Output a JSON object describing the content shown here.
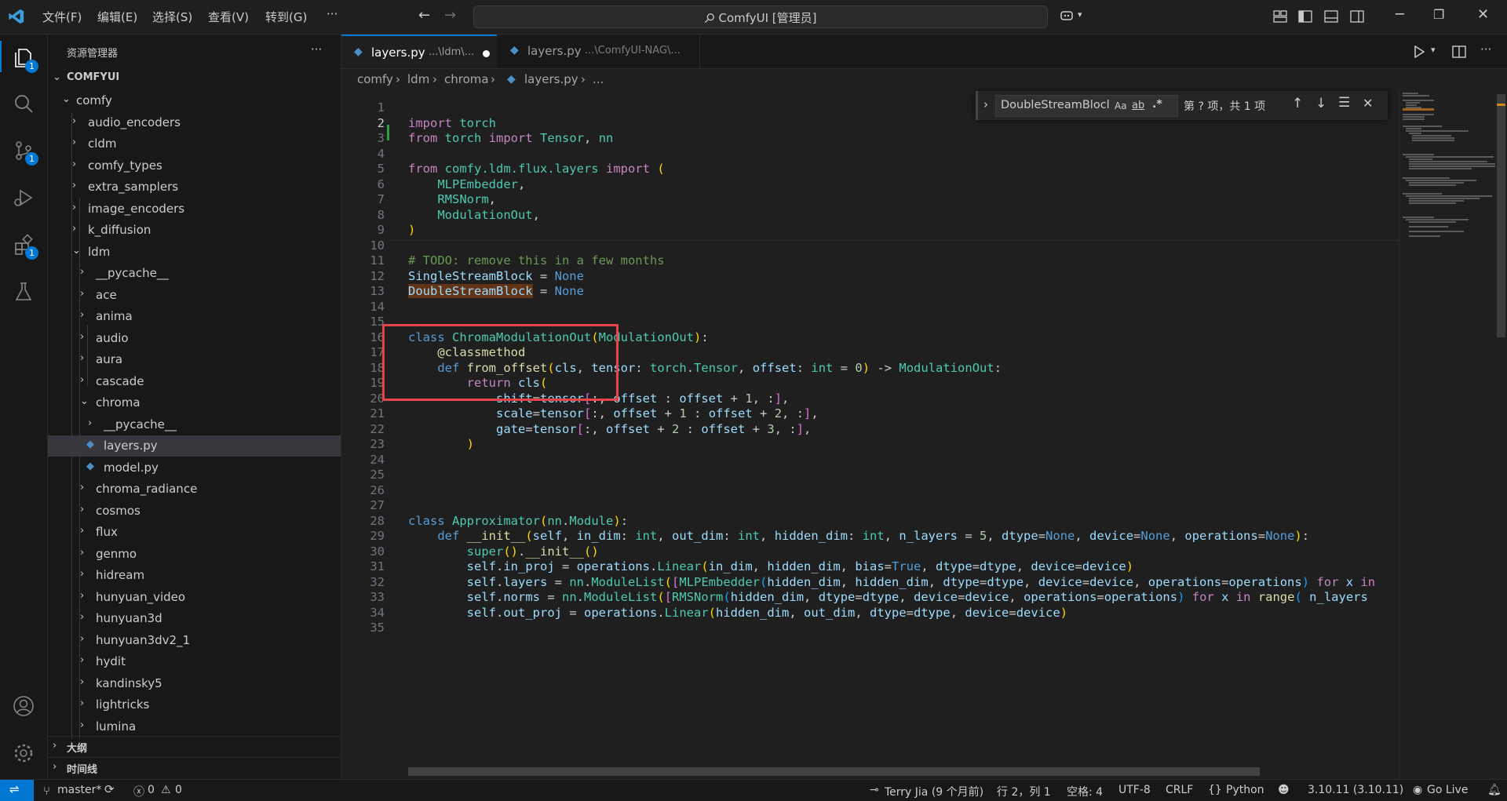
{
  "menu": [
    "文件(F)",
    "编辑(E)",
    "选择(S)",
    "查看(V)",
    "转到(G)",
    "···"
  ],
  "command_center": "ComfyUI [管理员]",
  "activity_badges": {
    "explorer": "1",
    "scm": "1",
    "extensions": "1"
  },
  "sidebar": {
    "title": "资源管理器",
    "more": "···",
    "root": "COMFYUI",
    "items": [
      {
        "label": "comfy",
        "depth": 1,
        "open": true
      },
      {
        "label": "audio_encoders",
        "depth": 2
      },
      {
        "label": "cldm",
        "depth": 2
      },
      {
        "label": "comfy_types",
        "depth": 2
      },
      {
        "label": "extra_samplers",
        "depth": 2
      },
      {
        "label": "image_encoders",
        "depth": 2
      },
      {
        "label": "k_diffusion",
        "depth": 2
      },
      {
        "label": "ldm",
        "depth": 2,
        "open": true
      },
      {
        "label": "__pycache__",
        "depth": 3
      },
      {
        "label": "ace",
        "depth": 3
      },
      {
        "label": "anima",
        "depth": 3
      },
      {
        "label": "audio",
        "depth": 3
      },
      {
        "label": "aura",
        "depth": 3
      },
      {
        "label": "cascade",
        "depth": 3
      },
      {
        "label": "chroma",
        "depth": 3,
        "open": true
      },
      {
        "label": "__pycache__",
        "depth": 4
      },
      {
        "label": "layers.py",
        "depth": 4,
        "file": true,
        "active": true
      },
      {
        "label": "model.py",
        "depth": 4,
        "file": true
      },
      {
        "label": "chroma_radiance",
        "depth": 3
      },
      {
        "label": "cosmos",
        "depth": 3
      },
      {
        "label": "flux",
        "depth": 3
      },
      {
        "label": "genmo",
        "depth": 3
      },
      {
        "label": "hidream",
        "depth": 3
      },
      {
        "label": "hunyuan_video",
        "depth": 3
      },
      {
        "label": "hunyuan3d",
        "depth": 3
      },
      {
        "label": "hunyuan3dv2_1",
        "depth": 3
      },
      {
        "label": "hydit",
        "depth": 3
      },
      {
        "label": "kandinsky5",
        "depth": 3
      },
      {
        "label": "lightricks",
        "depth": 3
      },
      {
        "label": "lumina",
        "depth": 3
      }
    ],
    "outline": "大纲",
    "timeline": "时间线"
  },
  "tabs": [
    {
      "name": "layers.py",
      "path": "...\\ldm\\...",
      "active": true,
      "dirty": true
    },
    {
      "name": "layers.py",
      "path": "...\\ComfyUI-NAG\\...",
      "active": false,
      "dirty": false
    }
  ],
  "breadcrumb": [
    "comfy",
    "ldm",
    "chroma",
    "layers.py",
    "..."
  ],
  "find": {
    "query": "DoubleStreamBlocl",
    "case": "Aa",
    "word": "ab",
    "regex": ".*",
    "result": "第 ? 项，共 1 项"
  },
  "code_lines": [
    {
      "n": "1",
      "html": ""
    },
    {
      "n": "2",
      "html": "<span class='ctl'>import</span> <span class='cls'>torch</span>"
    },
    {
      "n": "3",
      "html": "<span class='ctl'>from</span> <span class='cls'>torch</span> <span class='ctl'>import</span> <span class='cls'>Tensor</span>, <span class='cls'>nn</span>"
    },
    {
      "n": "4",
      "html": ""
    },
    {
      "n": "5",
      "html": "<span class='ctl'>from</span> <span class='cls'>comfy.ldm.flux.layers</span> <span class='ctl'>import</span> <span class='br1'>(</span>"
    },
    {
      "n": "6",
      "html": "    <span class='cls'>MLPEmbedder</span>,"
    },
    {
      "n": "7",
      "html": "    <span class='cls'>RMSNorm</span>,"
    },
    {
      "n": "8",
      "html": "    <span class='cls'>ModulationOut</span>,"
    },
    {
      "n": "9",
      "html": "<span class='br1'>)</span>"
    },
    {
      "n": "10",
      "html": ""
    },
    {
      "n": "11",
      "html": "<span class='cmt'># TODO: remove this in a few months</span>"
    },
    {
      "n": "12",
      "html": "<span class='var'>SingleStreamBlock</span> = <span class='kw'>None</span>"
    },
    {
      "n": "13",
      "html": "<span class='var hl'>DoubleStreamBlock</span> = <span class='kw'>None</span>"
    },
    {
      "n": "14",
      "html": ""
    },
    {
      "n": "15",
      "html": ""
    },
    {
      "n": "16",
      "html": "<span class='kw'>class</span> <span class='cls'>ChromaModulationOut</span><span class='br1'>(</span><span class='cls'>ModulationOut</span><span class='br1'>)</span>:"
    },
    {
      "n": "17",
      "html": "    <span class='dec'>@classmethod</span>"
    },
    {
      "n": "18",
      "html": "    <span class='kw'>def</span> <span class='fn'>from_offset</span><span class='br1'>(</span><span class='var'>cls</span>, <span class='var'>tensor</span>: <span class='cls'>torch</span>.<span class='cls'>Tensor</span>, <span class='var'>offset</span>: <span class='cls'>int</span> = <span class='num'>0</span><span class='br1'>)</span> -> <span class='cls'>ModulationOut</span>:"
    },
    {
      "n": "19",
      "html": "        <span class='ctl'>return</span> <span class='var'>cls</span><span class='br1'>(</span>"
    },
    {
      "n": "20",
      "html": "            <span class='var'>shift</span>=<span class='var'>tensor</span><span class='br2'>[</span>:, <span class='var'>offset</span> : <span class='var'>offset</span> + <span class='num'>1</span>, :<span class='br2'>]</span>,"
    },
    {
      "n": "21",
      "html": "            <span class='var'>scale</span>=<span class='var'>tensor</span><span class='br2'>[</span>:, <span class='var'>offset</span> + <span class='num'>1</span> : <span class='var'>offset</span> + <span class='num'>2</span>, :<span class='br2'>]</span>,"
    },
    {
      "n": "22",
      "html": "            <span class='var'>gate</span>=<span class='var'>tensor</span><span class='br2'>[</span>:, <span class='var'>offset</span> + <span class='num'>2</span> : <span class='var'>offset</span> + <span class='num'>3</span>, :<span class='br2'>]</span>,"
    },
    {
      "n": "23",
      "html": "        <span class='br1'>)</span>"
    },
    {
      "n": "24",
      "html": ""
    },
    {
      "n": "25",
      "html": ""
    },
    {
      "n": "26",
      "html": ""
    },
    {
      "n": "27",
      "html": ""
    },
    {
      "n": "28",
      "html": "<span class='kw'>class</span> <span class='cls'>Approximator</span><span class='br1'>(</span><span class='cls'>nn</span>.<span class='cls'>Module</span><span class='br1'>)</span>:"
    },
    {
      "n": "29",
      "html": "    <span class='kw'>def</span> <span class='fn'>__init__</span><span class='br1'>(</span><span class='var'>self</span>, <span class='var'>in_dim</span>: <span class='cls'>int</span>, <span class='var'>out_dim</span>: <span class='cls'>int</span>, <span class='var'>hidden_dim</span>: <span class='cls'>int</span>, <span class='var'>n_layers</span> = <span class='num'>5</span>, <span class='var'>dtype</span>=<span class='kw'>None</span>, <span class='var'>device</span>=<span class='kw'>None</span>, <span class='var'>operations</span>=<span class='kw'>None</span><span class='br1'>)</span>:"
    },
    {
      "n": "30",
      "html": "        <span class='cls'>super</span><span class='br1'>()</span>.<span class='fn'>__init__</span><span class='br1'>()</span>"
    },
    {
      "n": "31",
      "html": "        <span class='var'>self</span>.<span class='var'>in_proj</span> = <span class='var'>operations</span>.<span class='cls'>Linear</span><span class='br1'>(</span><span class='var'>in_dim</span>, <span class='var'>hidden_dim</span>, <span class='var'>bias</span>=<span class='kw'>True</span>, <span class='var'>dtype</span>=<span class='var'>dtype</span>, <span class='var'>device</span>=<span class='var'>device</span><span class='br1'>)</span>"
    },
    {
      "n": "32",
      "html": "        <span class='var'>self</span>.<span class='var'>layers</span> = <span class='cls'>nn</span>.<span class='cls'>ModuleList</span><span class='br1'>(</span><span class='br2'>[</span><span class='cls'>MLPEmbedder</span><span class='br3'>(</span><span class='var'>hidden_dim</span>, <span class='var'>hidden_dim</span>, <span class='var'>dtype</span>=<span class='var'>dtype</span>, <span class='var'>device</span>=<span class='var'>device</span>, <span class='var'>operations</span>=<span class='var'>operations</span><span class='br3'>)</span> <span class='ctl'>for</span> <span class='var'>x</span> <span class='ctl'>in</span>"
    },
    {
      "n": "33",
      "html": "        <span class='var'>self</span>.<span class='var'>norms</span> = <span class='cls'>nn</span>.<span class='cls'>ModuleList</span><span class='br1'>(</span><span class='br2'>[</span><span class='cls'>RMSNorm</span><span class='br3'>(</span><span class='var'>hidden_dim</span>, <span class='var'>dtype</span>=<span class='var'>dtype</span>, <span class='var'>device</span>=<span class='var'>device</span>, <span class='var'>operations</span>=<span class='var'>operations</span><span class='br3'>)</span> <span class='ctl'>for</span> <span class='var'>x</span> <span class='ctl'>in</span> <span class='fn'>range</span><span class='br3'>(</span> <span class='var'>n_layers</span>"
    },
    {
      "n": "34",
      "html": "        <span class='var'>self</span>.<span class='var'>out_proj</span> = <span class='var'>operations</span>.<span class='cls'>Linear</span><span class='br1'>(</span><span class='var'>hidden_dim</span>, <span class='var'>out_dim</span>, <span class='var'>dtype</span>=<span class='var'>dtype</span>, <span class='var'>device</span>=<span class='var'>device</span><span class='br1'>)</span>"
    },
    {
      "n": "35",
      "html": ""
    }
  ],
  "status": {
    "branch": "master*",
    "errors": "0",
    "warnings": "0",
    "blame": "Terry Jia (9 个月前)",
    "position": "行 2，列 1",
    "spaces": "空格: 4",
    "encoding": "UTF-8",
    "eol": "CRLF",
    "language": "Python",
    "python_version": "3.10.11 (3.10.11)",
    "golive": "Go Live"
  },
  "colors": {
    "accent": "#0078d4",
    "highlight_box": "#e8434a",
    "find_match": "#623315"
  }
}
